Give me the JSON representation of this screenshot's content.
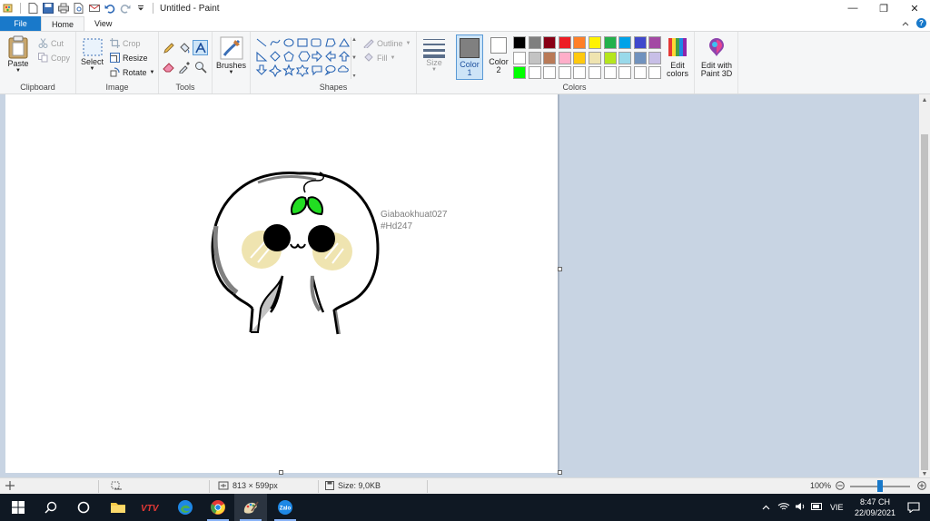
{
  "window": {
    "title": "Untitled - Paint",
    "minimize_glyph": "—",
    "restore_glyph": "❐",
    "close_glyph": "✕"
  },
  "tabs": {
    "file": "File",
    "home": "Home",
    "view": "View"
  },
  "ribbon": {
    "clipboard": {
      "paste": "Paste",
      "cut": "Cut",
      "copy": "Copy",
      "label": "Clipboard"
    },
    "image": {
      "select": "Select",
      "crop": "Crop",
      "resize": "Resize",
      "rotate": "Rotate",
      "label": "Image"
    },
    "tools": {
      "label": "Tools"
    },
    "brushes": {
      "label": "Brushes"
    },
    "shapes": {
      "outline": "Outline",
      "fill": "Fill",
      "label": "Shapes"
    },
    "size": {
      "label": "Size"
    },
    "color1": {
      "label_line1": "Color",
      "label_line2": "1",
      "value": "#808080"
    },
    "color2": {
      "label_line1": "Color",
      "label_line2": "2",
      "value": "#ffffff"
    },
    "colors": {
      "label": "Colors",
      "palette": [
        "#000000",
        "#7f7f7f",
        "#880015",
        "#ed1c24",
        "#ff7f27",
        "#fff200",
        "#22b14c",
        "#00a2e8",
        "#3f48cc",
        "#a349a4",
        "#ffffff",
        "#c3c3c3",
        "#b97a57",
        "#ffaec9",
        "#ffc90e",
        "#efe4b0",
        "#b5e61d",
        "#99d9ea",
        "#7092be",
        "#c8bfe7",
        "#00ff00",
        "#ffffff",
        "#ffffff",
        "#ffffff",
        "#ffffff",
        "#ffffff",
        "#ffffff",
        "#ffffff",
        "#ffffff",
        "#ffffff"
      ]
    },
    "edit_colors": {
      "line1": "Edit",
      "line2": "colors"
    },
    "paint3d": {
      "line1": "Edit with",
      "line2": "Paint 3D"
    }
  },
  "canvas": {
    "text_line1": "Giabaokhuat027",
    "text_line2": "#Hd247"
  },
  "status": {
    "dimensions": "813 × 599px",
    "size": "Size: 9,0KB",
    "zoom": "100%"
  },
  "taskbar": {
    "language": "VIE",
    "time": "8:47 CH",
    "date": "22/09/2021"
  }
}
